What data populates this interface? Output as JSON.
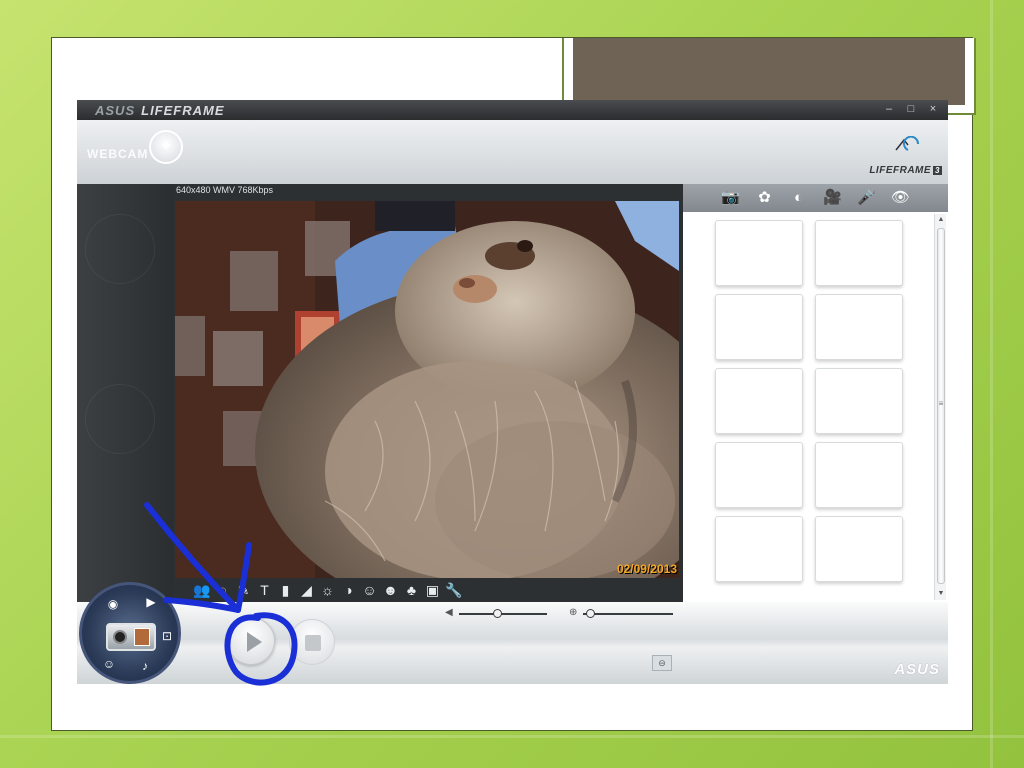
{
  "app": {
    "brand_asus": "ASUS",
    "brand_name": "LIFEFRAME",
    "window_controls": [
      "–",
      "□",
      "×"
    ]
  },
  "header": {
    "webcam_label": "WEBCAM",
    "logo_name": "LIFEFRAME",
    "logo_version": "3"
  },
  "video": {
    "resolution_info": "640x480 WMV 768Kbps",
    "date_stamp": "02/09/2013",
    "scene": "webcam view of a long-haired gray Persian cat"
  },
  "effects_toolbar": {
    "icons": [
      "people-effect-icon",
      "frame-effect-icon",
      "brush-effect-icon",
      "text-effect-icon",
      "sticker-effect-icon",
      "contrast-ramp-icon",
      "brightness-icon",
      "contrast-icon",
      "face-mask-icon",
      "emoticon-icon",
      "color-blend-icon",
      "photo-frame-icon",
      "wrench-icon"
    ],
    "glyphs": [
      "👥",
      "◌",
      "✎",
      "T",
      "▮",
      "◢",
      "☼",
      "◑",
      "☺",
      "☻",
      "♣",
      "▣",
      "🔧"
    ]
  },
  "right_panel": {
    "tabs": [
      {
        "name": "camera-tab-icon",
        "glyph": "📷"
      },
      {
        "name": "effects-tab-icon",
        "glyph": "✿"
      },
      {
        "name": "face-tab-icon",
        "glyph": "◐"
      },
      {
        "name": "video-camera-tab-icon",
        "glyph": "🎥"
      },
      {
        "name": "microphone-tab-icon",
        "glyph": "🎤"
      },
      {
        "name": "eye-tab-icon",
        "glyph": "👁"
      }
    ],
    "thumbnail_count": 10
  },
  "bottom_bar": {
    "volume_level": 0.43,
    "zoom_level": 0.08,
    "asus_logo": "ASUS",
    "mode_wheel": [
      "eye",
      "play",
      "camera",
      "mic",
      "face"
    ]
  },
  "annotation": {
    "color": "#1a2fd6"
  }
}
